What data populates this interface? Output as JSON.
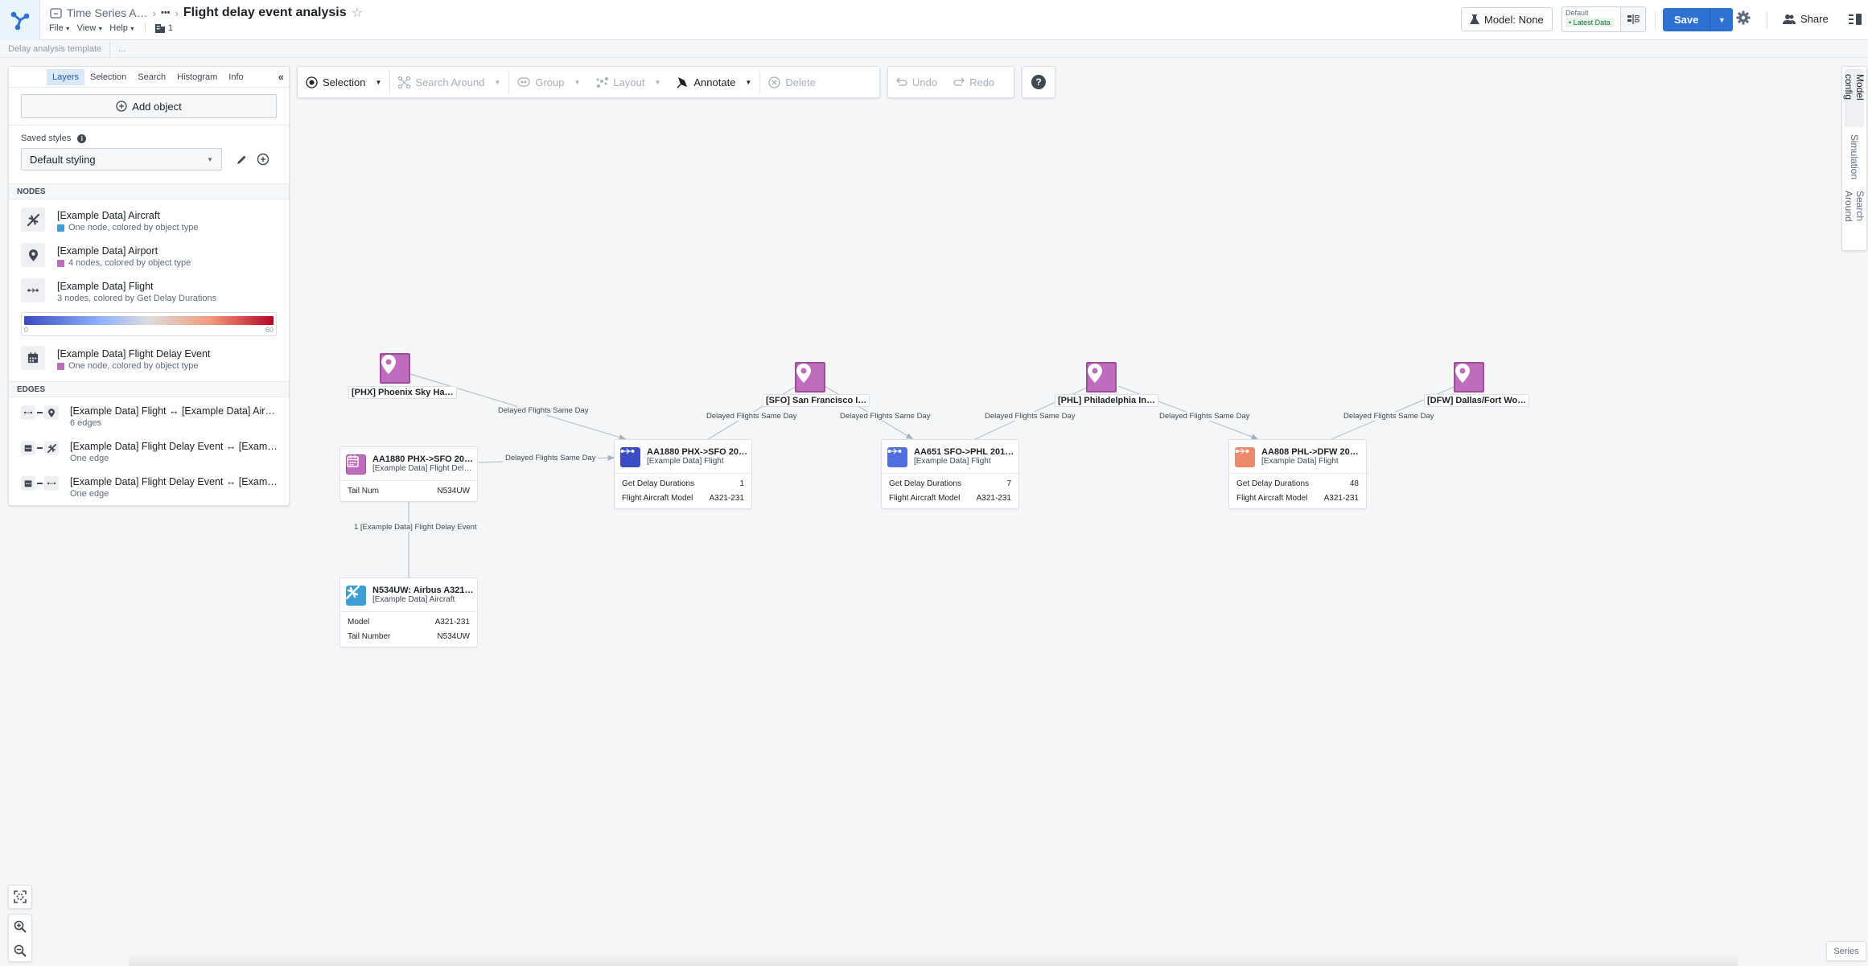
{
  "header": {
    "breadcrumb_parent": "Time Series A…",
    "breadcrumb_more": "•••",
    "title": "Flight delay event analysis",
    "menus": [
      {
        "label": "File"
      },
      {
        "label": "View"
      },
      {
        "label": "Help"
      }
    ],
    "object_count": "1",
    "model_button": "Model: None",
    "scenario_label": "Default",
    "scenario_badge": "• Latest Data",
    "save_label": "Save",
    "share_label": "Share"
  },
  "subbar": {
    "template_label": "Delay analysis template",
    "more_label": "..."
  },
  "left_panel": {
    "tabs": [
      {
        "label": "Layers",
        "active": true
      },
      {
        "label": "Selection",
        "active": false
      },
      {
        "label": "Search",
        "active": false
      },
      {
        "label": "Histogram",
        "active": false
      },
      {
        "label": "Info",
        "active": false
      }
    ],
    "collapse_label": "«",
    "add_object_label": "Add object",
    "saved_styles_label": "Saved styles",
    "saved_styles_value": "Default styling",
    "nodes_header": "NODES",
    "nodes": [
      {
        "title": "[Example Data] Aircraft",
        "subtitle": "One node, colored by object type",
        "color": "#3d9fd6",
        "icon": "airplane-icon"
      },
      {
        "title": "[Example Data] Airport",
        "subtitle": "4 nodes, colored by object type",
        "color": "#c06cbd",
        "icon": "map-marker-icon"
      },
      {
        "title": "[Example Data] Flight",
        "subtitle": "3 nodes, colored by Get Delay Durations",
        "color": null,
        "icon": "flight-route-icon"
      },
      {
        "title": "[Example Data] Flight Delay Event",
        "subtitle": "One node, colored by object type",
        "color": "#c06cbd",
        "icon": "calendar-icon"
      }
    ],
    "gradient": {
      "min": "0",
      "max": "60"
    },
    "edges_header": "EDGES",
    "edges": [
      {
        "title": "[Example Data] Flight ↔ [Example Data] Air…",
        "subtitle": "6 edges"
      },
      {
        "title": "[Example Data] Flight Delay Event ↔ [Exam…",
        "subtitle": "One edge"
      },
      {
        "title": "[Example Data] Flight Delay Event ↔ [Exam…",
        "subtitle": "One edge"
      }
    ]
  },
  "toolbar": {
    "selection": "Selection",
    "search_around": "Search Around",
    "group": "Group",
    "layout": "Layout",
    "annotate": "Annotate",
    "delete": "Delete",
    "undo": "Undo",
    "redo": "Redo",
    "help": "?"
  },
  "right_tabs": [
    {
      "label": "Model config",
      "active": true
    },
    {
      "label": "Simulation",
      "active": false
    },
    {
      "label": "Search Around",
      "active": false
    }
  ],
  "graph": {
    "airports": [
      {
        "label": "[PHX] Phoenix Sky Ha…"
      },
      {
        "label": "[SFO] San Francisco I…"
      },
      {
        "label": "[PHL] Philadelphia In…"
      },
      {
        "label": "[DFW] Dallas/Fort Wo…"
      }
    ],
    "edge_label": "Delayed Flights Same Day",
    "event_edge_label": "1 [Example Data] Flight Delay Event",
    "cards": [
      {
        "title": "AA1880 PHX->SFO 2018-…",
        "subtitle": "[Example Data] Flight Dela…",
        "icon_color": "#c06cbd",
        "rows": [
          {
            "k": "Tail Num",
            "v": "N534UW"
          }
        ]
      },
      {
        "title": "AA1880 PHX->SFO 2018-…",
        "subtitle": "[Example Data] Flight",
        "icon_color": "#3a4cc0",
        "rows": [
          {
            "k": "Get Delay Durations",
            "v": "1"
          },
          {
            "k": "Flight Aircraft Model",
            "v": "A321-231"
          }
        ]
      },
      {
        "title": "AA651 SFO->PHL 2018-0…",
        "subtitle": "[Example Data] Flight",
        "icon_color": "#4f6fdf",
        "rows": [
          {
            "k": "Get Delay Durations",
            "v": "7"
          },
          {
            "k": "Flight Aircraft Model",
            "v": "A321-231"
          }
        ]
      },
      {
        "title": "AA808 PHL->DFW 2018-…",
        "subtitle": "[Example Data] Flight",
        "icon_color": "#ee8a6c",
        "rows": [
          {
            "k": "Get Delay Durations",
            "v": "48"
          },
          {
            "k": "Flight Aircraft Model",
            "v": "A321-231"
          }
        ]
      },
      {
        "title": "N534UW: Airbus A321-231",
        "subtitle": "[Example Data] Aircraft",
        "icon_color": "#3d9fd6",
        "rows": [
          {
            "k": "Model",
            "v": "A321-231"
          },
          {
            "k": "Tail Number",
            "v": "N534UW"
          }
        ]
      }
    ]
  },
  "series_label": "Series"
}
